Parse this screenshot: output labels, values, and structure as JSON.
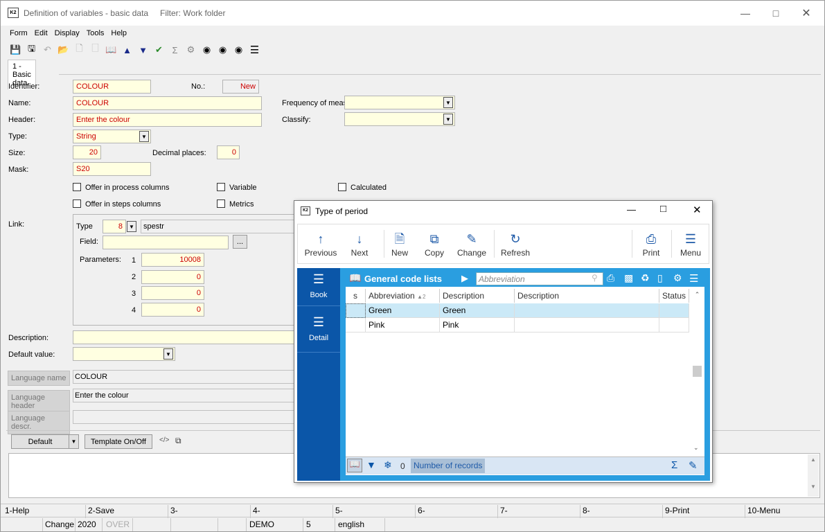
{
  "window": {
    "title": "Definition of variables - basic data",
    "filter": "Filter: Work folder"
  },
  "menu": [
    "Form",
    "Edit",
    "Display",
    "Tools",
    "Help"
  ],
  "tab": "1 - Basic data",
  "form": {
    "identifier_label": "Identifier:",
    "identifier": "COLOUR",
    "no_label": "No.:",
    "no_value": "New",
    "name_label": "Name:",
    "name": "COLOUR",
    "header_label": "Header:",
    "header": "Enter the colour",
    "type_label": "Type:",
    "type": "String",
    "size_label": "Size:",
    "size": "20",
    "decimal_label": "Decimal places:",
    "decimal": "0",
    "mask_label": "Mask:",
    "mask": "S20",
    "freq_label": "Frequency of meas",
    "classify_label": "Classify:",
    "chk_offer_process": "Offer in process columns",
    "chk_offer_steps": "Offer in steps columns",
    "chk_variable": "Variable",
    "chk_metrics": "Metrics",
    "chk_calculated": "Calculated",
    "link_label": "Link:",
    "link_type_label": "Type",
    "link_type": "8",
    "link_type_name": "spestr",
    "field_label": "Field:",
    "field_btn": "...",
    "params_label": "Parameters:",
    "params": [
      {
        "n": "1",
        "v": "10008"
      },
      {
        "n": "2",
        "v": "0"
      },
      {
        "n": "3",
        "v": "0"
      },
      {
        "n": "4",
        "v": "0"
      }
    ],
    "description_label": "Description:",
    "default_label": "Default value:",
    "lang_name_btn": "Language name",
    "lang_name": "COLOUR",
    "lang_header_btn": "Language header",
    "lang_header": "Enter the colour",
    "lang_descr_btn": "Language descr.",
    "default_btn": "Default",
    "template_btn": "Template On/Off"
  },
  "fkeys": [
    "1-Help",
    "2-Save",
    "3-",
    "4-",
    "5-",
    "6-",
    "7-",
    "8-",
    "9-Print",
    "10-Menu"
  ],
  "status": {
    "mode": "Change",
    "year": "2020",
    "over": "OVER",
    "db": "DEMO",
    "num": "5",
    "lang": "english"
  },
  "popup": {
    "title": "Type of period",
    "toolbar": [
      "Previous",
      "Next",
      "New",
      "Copy",
      "Change",
      "Refresh",
      "Print",
      "Menu"
    ],
    "side": [
      "Book",
      "Detail"
    ],
    "grid_title": "General code lists",
    "search_placeholder": "Abbreviation",
    "columns": [
      "s",
      "Abbreviation",
      "Description",
      "Description",
      "Status"
    ],
    "sort_indicator": "2",
    "rows": [
      {
        "abbr": "Green",
        "desc": "Green"
      },
      {
        "abbr": "Pink",
        "desc": "Pink"
      }
    ],
    "footer_count": "0",
    "footer_label": "Number of records"
  }
}
